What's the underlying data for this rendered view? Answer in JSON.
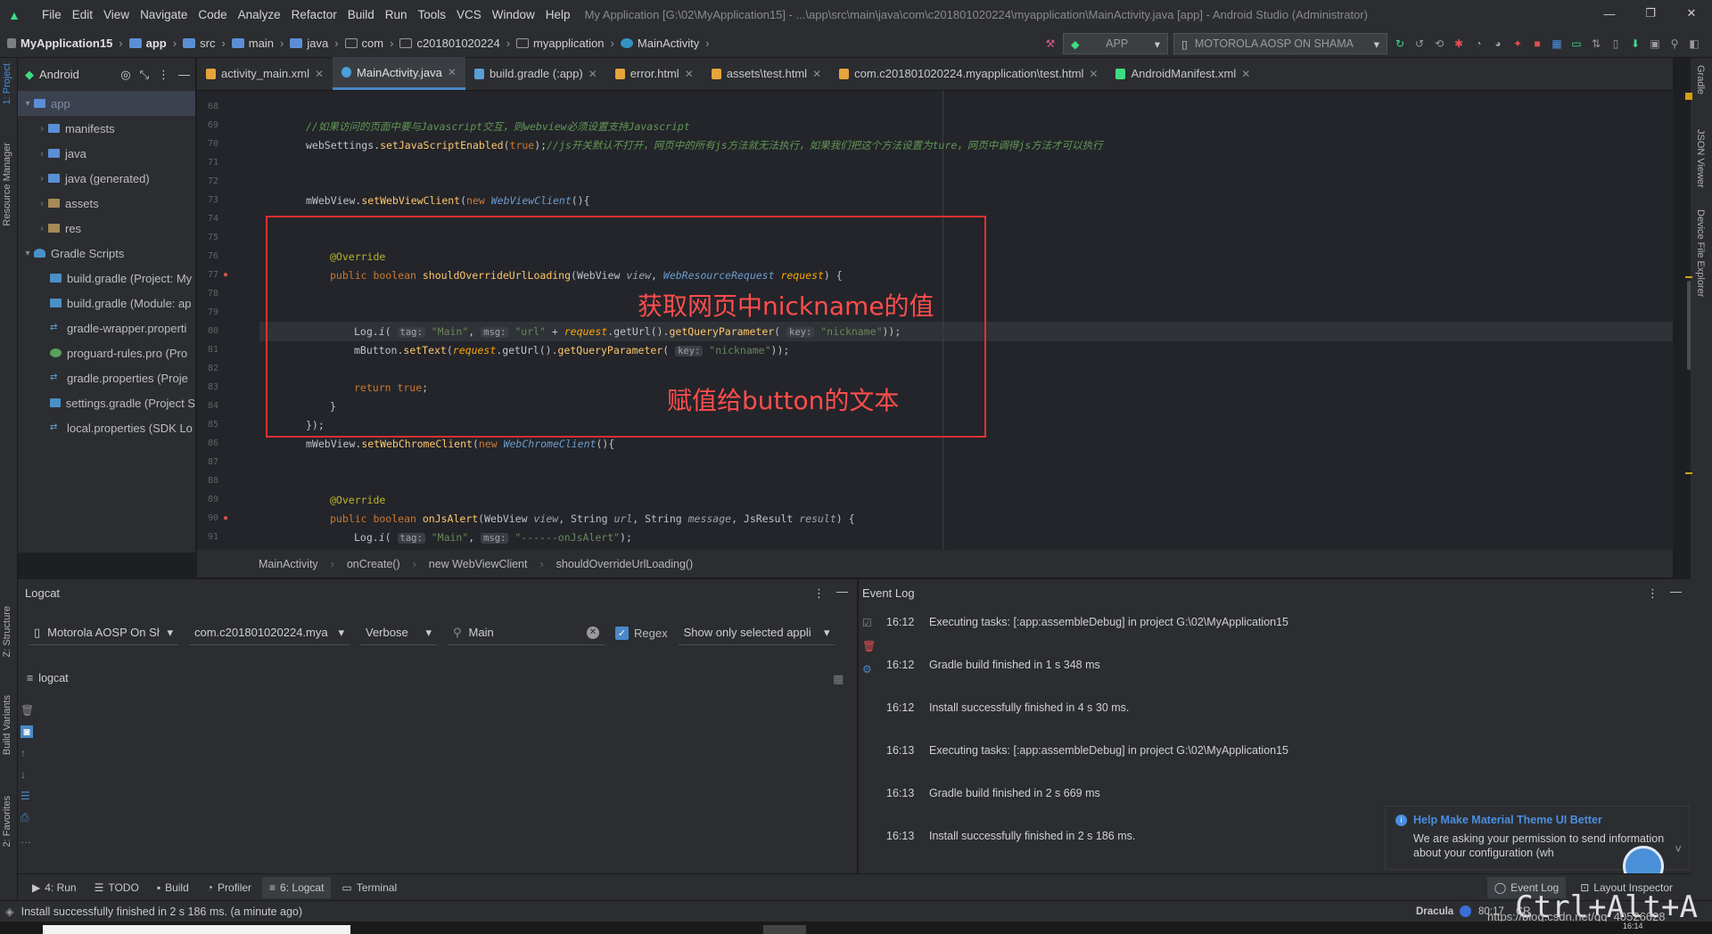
{
  "window": {
    "title": "My Application [G:\\02\\MyApplication15] - ...\\app\\src\\main\\java\\com\\c201801020224\\myapplication\\MainActivity.java [app] - Android Studio (Administrator)",
    "menu": [
      "File",
      "Edit",
      "View",
      "Navigate",
      "Code",
      "Analyze",
      "Refactor",
      "Build",
      "Run",
      "Tools",
      "VCS",
      "Window",
      "Help"
    ],
    "controls": [
      "—",
      "❐",
      "✕"
    ]
  },
  "navbar": {
    "crumbs": [
      "MyApplication15",
      "app",
      "src",
      "main",
      "java",
      "com",
      "c201801020224",
      "myapplication",
      "MainActivity"
    ],
    "run_config": "APP",
    "device": "MOTOROLA AOSP ON SHAMA"
  },
  "side_left": {
    "project": "1: Project",
    "resource_manager": "Resource Manager",
    "structure": "Z: Structure",
    "build_variants": "Build Variants",
    "favorites": "2: Favorites"
  },
  "side_right": {
    "gradle": "Gradle",
    "json_viewer": "JSON Viewer",
    "device_file_explorer": "Device File Explorer"
  },
  "project": {
    "header": "Android",
    "items": [
      {
        "label": "app",
        "level": 0,
        "expanded": true
      },
      {
        "label": "manifests",
        "level": 1
      },
      {
        "label": "java",
        "level": 1
      },
      {
        "label": "java (generated)",
        "level": 1
      },
      {
        "label": "assets",
        "level": 1
      },
      {
        "label": "res",
        "level": 1
      },
      {
        "label": "Gradle Scripts",
        "level": 0,
        "expanded": true
      },
      {
        "label": "build.gradle (Project: My",
        "level": 1
      },
      {
        "label": "build.gradle (Module: ap",
        "level": 1
      },
      {
        "label": "gradle-wrapper.properti",
        "level": 1
      },
      {
        "label": "proguard-rules.pro (Pro",
        "level": 1
      },
      {
        "label": "gradle.properties (Proje",
        "level": 1
      },
      {
        "label": "settings.gradle (Project S",
        "level": 1
      },
      {
        "label": "local.properties (SDK Lo",
        "level": 1
      }
    ]
  },
  "tabs": [
    {
      "label": "activity_main.xml",
      "active": false,
      "color": "#e8a33d"
    },
    {
      "label": "MainActivity.java",
      "active": true,
      "color": "#4a9fd8"
    },
    {
      "label": "build.gradle (:app)",
      "active": false,
      "color": "#5a9fd4"
    },
    {
      "label": "error.html",
      "active": false,
      "color": "#e8a33d"
    },
    {
      "label": "assets\\test.html",
      "active": false,
      "color": "#e8a33d"
    },
    {
      "label": "com.c201801020224.myapplication\\test.html",
      "active": false,
      "color": "#e8a33d"
    },
    {
      "label": "AndroidManifest.xml",
      "active": false,
      "color": "#3ddc84"
    }
  ],
  "editor": {
    "line_numbers": [
      "68",
      "69",
      "70",
      "71",
      "72",
      "73",
      "74",
      "75",
      "76",
      "77",
      "78",
      "79",
      "80",
      "81",
      "82",
      "83",
      "84",
      "85",
      "86",
      "87",
      "88",
      "89",
      "90",
      "91"
    ],
    "l69_comment": "//如果访问的页面中要与Javascript交互，则webview必须设置支持Javascript",
    "l70_a": "webSettings.",
    "l70_fn": "setJavaScriptEnabled",
    "l70_b": "(",
    "l70_kw": "true",
    "l70_c": ");",
    "l70_comment": "//js开关默认不打开，网页中的所有js方法就无法执行，如果我们把这个方法设置为ture，网页中调得js方法才可以执行",
    "l73_a": "mWebView.",
    "l73_fn": "setWebViewClient",
    "l73_b": "(",
    "l73_kw": "new ",
    "l73_t": "WebViewClient",
    "l73_c": "(){",
    "l76": "@Override",
    "l77_kw": "public boolean ",
    "l77_fn": "shouldOverrideUrlLoading",
    "l77_a": "(WebView ",
    "l77_p1": "view",
    "l77_b": ", ",
    "l77_t": "WebResourceRequest",
    "l77_p2": " request",
    "l77_c": ") {",
    "l80_a": "Log.",
    "l80_i": "i",
    "l80_b": "( ",
    "l80_h1": "tag:",
    "l80_s1": " \"Main\"",
    "l80_c": ", ",
    "l80_h2": "msg:",
    "l80_s2": " \"url\"",
    "l80_d": " + ",
    "l80_p": "request",
    "l80_e": ".getUrl().",
    "l80_fn": "getQueryParameter",
    "l80_f": "( ",
    "l80_h3": "key:",
    "l80_s3": " \"nickname\"",
    "l80_g": "));",
    "l81_a": "mButton.",
    "l81_fn": "setText",
    "l81_b": "(",
    "l81_p": "request",
    "l81_c": ".getUrl().",
    "l81_fn2": "getQueryParameter",
    "l81_d": "( ",
    "l81_h": "key:",
    "l81_s": " \"nickname\"",
    "l81_e": "));",
    "l83_kw": "return true",
    "l83_a": ";",
    "l84": "}",
    "l85": "});",
    "l86_a": "mWebView.",
    "l86_fn": "setWebChromeClient",
    "l86_b": "(",
    "l86_kw": "new ",
    "l86_t": "WebChromeClient",
    "l86_c": "(){",
    "l89": "@Override",
    "l90_kw": "public boolean ",
    "l90_fn": "onJsAlert",
    "l90_a": "(WebView ",
    "l90_p1": "view",
    "l90_b": ", String ",
    "l90_p2": "url",
    "l90_c": ", String ",
    "l90_p3": "message",
    "l90_d": ", JsResult ",
    "l90_p4": "result",
    "l90_e": ") {",
    "l91_a": "Log.",
    "l91_i": "i",
    "l91_b": "( ",
    "l91_h1": "tag:",
    "l91_s1": " \"Main\"",
    "l91_c": ", ",
    "l91_h2": "msg:",
    "l91_s2": " \"------onJsAlert\"",
    "l91_d": ");",
    "annotation1": "获取网页中nickname的值",
    "annotation2": "赋值给button的文本"
  },
  "breadcrumb": [
    "MainActivity",
    "onCreate()",
    "new WebViewClient",
    "shouldOverrideUrlLoading()"
  ],
  "logcat": {
    "title": "Logcat",
    "device": "Motorola AOSP On Sh",
    "package": "com.c201801020224.mya",
    "level": "Verbose",
    "search": "Main",
    "regex_label": "Regex",
    "filter": "Show only selected appli",
    "tree_label": "logcat"
  },
  "event_log": {
    "title": "Event Log",
    "entries": [
      {
        "time": "16:12",
        "text": "Executing tasks: [:app:assembleDebug] in project G:\\02\\MyApplication15"
      },
      {
        "time": "16:12",
        "text": "Gradle build finished in 1 s 348 ms"
      },
      {
        "time": "16:12",
        "text": "Install successfully finished in 4 s 30 ms."
      },
      {
        "time": "16:13",
        "text": "Executing tasks: [:app:assembleDebug] in project G:\\02\\MyApplication15"
      },
      {
        "time": "16:13",
        "text": "Gradle build finished in 2 s 669 ms"
      },
      {
        "time": "16:13",
        "text": "Install successfully finished in 2 s 186 ms."
      }
    ]
  },
  "notification": {
    "title": "Help Make Material Theme UI Better",
    "body": "We are asking your permission to send information about your configuration (wh"
  },
  "bottom_tabs": [
    {
      "label": "4: Run",
      "active": false
    },
    {
      "label": "TODO",
      "active": false
    },
    {
      "label": "Build",
      "active": false
    },
    {
      "label": "Profiler",
      "active": false
    },
    {
      "label": "6: Logcat",
      "active": true
    },
    {
      "label": "Terminal",
      "active": false
    }
  ],
  "bottom_right_tabs": [
    "Event Log",
    "Layout Inspector"
  ],
  "status": {
    "message": "Install successfully finished in 2 s 186 ms. (a minute ago)",
    "theme": "Dracula",
    "position": "80:17",
    "cr": "CR",
    "shortcut_overlay": "Ctrl+Alt+A",
    "watermark": "https://blog.csdn.net/qq_40526628",
    "clock": "16:14"
  }
}
